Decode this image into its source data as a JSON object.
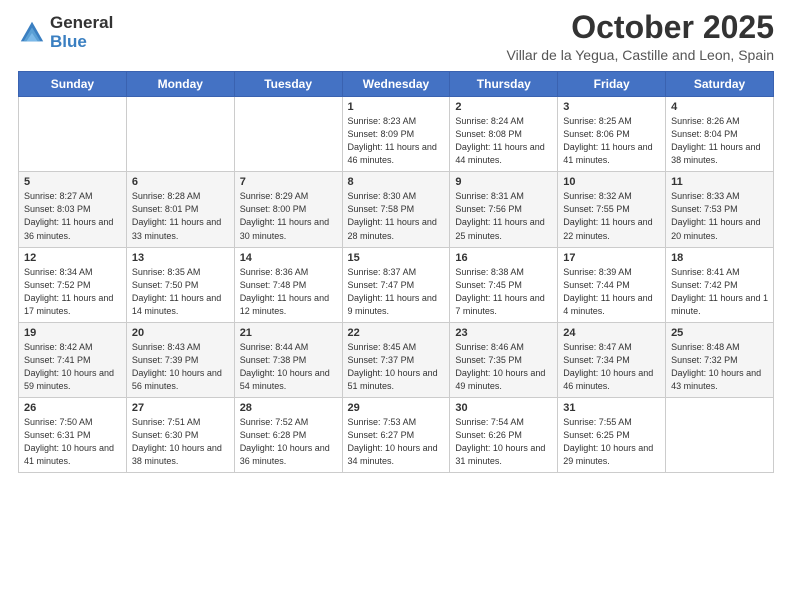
{
  "logo": {
    "general": "General",
    "blue": "Blue"
  },
  "title": {
    "month": "October 2025",
    "location": "Villar de la Yegua, Castille and Leon, Spain"
  },
  "calendar": {
    "days_of_week": [
      "Sunday",
      "Monday",
      "Tuesday",
      "Wednesday",
      "Thursday",
      "Friday",
      "Saturday"
    ],
    "weeks": [
      [
        {
          "day": "",
          "info": ""
        },
        {
          "day": "",
          "info": ""
        },
        {
          "day": "",
          "info": ""
        },
        {
          "day": "1",
          "info": "Sunrise: 8:23 AM\nSunset: 8:09 PM\nDaylight: 11 hours and 46 minutes."
        },
        {
          "day": "2",
          "info": "Sunrise: 8:24 AM\nSunset: 8:08 PM\nDaylight: 11 hours and 44 minutes."
        },
        {
          "day": "3",
          "info": "Sunrise: 8:25 AM\nSunset: 8:06 PM\nDaylight: 11 hours and 41 minutes."
        },
        {
          "day": "4",
          "info": "Sunrise: 8:26 AM\nSunset: 8:04 PM\nDaylight: 11 hours and 38 minutes."
        }
      ],
      [
        {
          "day": "5",
          "info": "Sunrise: 8:27 AM\nSunset: 8:03 PM\nDaylight: 11 hours and 36 minutes."
        },
        {
          "day": "6",
          "info": "Sunrise: 8:28 AM\nSunset: 8:01 PM\nDaylight: 11 hours and 33 minutes."
        },
        {
          "day": "7",
          "info": "Sunrise: 8:29 AM\nSunset: 8:00 PM\nDaylight: 11 hours and 30 minutes."
        },
        {
          "day": "8",
          "info": "Sunrise: 8:30 AM\nSunset: 7:58 PM\nDaylight: 11 hours and 28 minutes."
        },
        {
          "day": "9",
          "info": "Sunrise: 8:31 AM\nSunset: 7:56 PM\nDaylight: 11 hours and 25 minutes."
        },
        {
          "day": "10",
          "info": "Sunrise: 8:32 AM\nSunset: 7:55 PM\nDaylight: 11 hours and 22 minutes."
        },
        {
          "day": "11",
          "info": "Sunrise: 8:33 AM\nSunset: 7:53 PM\nDaylight: 11 hours and 20 minutes."
        }
      ],
      [
        {
          "day": "12",
          "info": "Sunrise: 8:34 AM\nSunset: 7:52 PM\nDaylight: 11 hours and 17 minutes."
        },
        {
          "day": "13",
          "info": "Sunrise: 8:35 AM\nSunset: 7:50 PM\nDaylight: 11 hours and 14 minutes."
        },
        {
          "day": "14",
          "info": "Sunrise: 8:36 AM\nSunset: 7:48 PM\nDaylight: 11 hours and 12 minutes."
        },
        {
          "day": "15",
          "info": "Sunrise: 8:37 AM\nSunset: 7:47 PM\nDaylight: 11 hours and 9 minutes."
        },
        {
          "day": "16",
          "info": "Sunrise: 8:38 AM\nSunset: 7:45 PM\nDaylight: 11 hours and 7 minutes."
        },
        {
          "day": "17",
          "info": "Sunrise: 8:39 AM\nSunset: 7:44 PM\nDaylight: 11 hours and 4 minutes."
        },
        {
          "day": "18",
          "info": "Sunrise: 8:41 AM\nSunset: 7:42 PM\nDaylight: 11 hours and 1 minute."
        }
      ],
      [
        {
          "day": "19",
          "info": "Sunrise: 8:42 AM\nSunset: 7:41 PM\nDaylight: 10 hours and 59 minutes."
        },
        {
          "day": "20",
          "info": "Sunrise: 8:43 AM\nSunset: 7:39 PM\nDaylight: 10 hours and 56 minutes."
        },
        {
          "day": "21",
          "info": "Sunrise: 8:44 AM\nSunset: 7:38 PM\nDaylight: 10 hours and 54 minutes."
        },
        {
          "day": "22",
          "info": "Sunrise: 8:45 AM\nSunset: 7:37 PM\nDaylight: 10 hours and 51 minutes."
        },
        {
          "day": "23",
          "info": "Sunrise: 8:46 AM\nSunset: 7:35 PM\nDaylight: 10 hours and 49 minutes."
        },
        {
          "day": "24",
          "info": "Sunrise: 8:47 AM\nSunset: 7:34 PM\nDaylight: 10 hours and 46 minutes."
        },
        {
          "day": "25",
          "info": "Sunrise: 8:48 AM\nSunset: 7:32 PM\nDaylight: 10 hours and 43 minutes."
        }
      ],
      [
        {
          "day": "26",
          "info": "Sunrise: 7:50 AM\nSunset: 6:31 PM\nDaylight: 10 hours and 41 minutes."
        },
        {
          "day": "27",
          "info": "Sunrise: 7:51 AM\nSunset: 6:30 PM\nDaylight: 10 hours and 38 minutes."
        },
        {
          "day": "28",
          "info": "Sunrise: 7:52 AM\nSunset: 6:28 PM\nDaylight: 10 hours and 36 minutes."
        },
        {
          "day": "29",
          "info": "Sunrise: 7:53 AM\nSunset: 6:27 PM\nDaylight: 10 hours and 34 minutes."
        },
        {
          "day": "30",
          "info": "Sunrise: 7:54 AM\nSunset: 6:26 PM\nDaylight: 10 hours and 31 minutes."
        },
        {
          "day": "31",
          "info": "Sunrise: 7:55 AM\nSunset: 6:25 PM\nDaylight: 10 hours and 29 minutes."
        },
        {
          "day": "",
          "info": ""
        }
      ]
    ]
  }
}
